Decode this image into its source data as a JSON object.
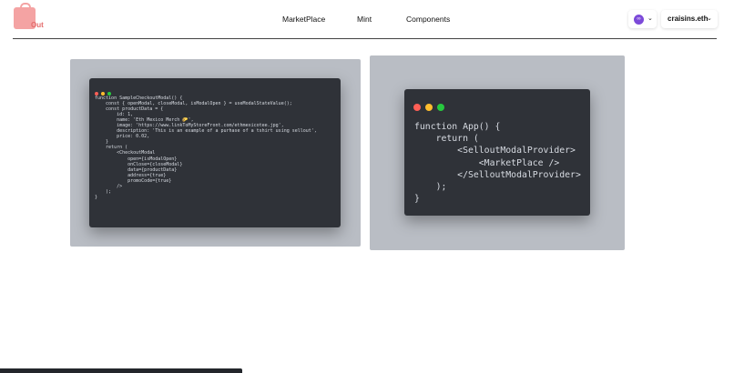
{
  "brand": {
    "logo_text": "Out",
    "accent": "#e46b6b"
  },
  "nav": {
    "items": [
      "MarketPlace",
      "Mint",
      "Components"
    ]
  },
  "wallet": {
    "chain_icon": "polygon-icon",
    "account": "craisins.eth"
  },
  "code_left": {
    "lines": [
      "function SampleCheckoutModal() {",
      "    const { openModal, closeModal, isModalOpen } = useModalStateValue();",
      "    const productData = {",
      "        id: 1,",
      "        name: 'Eth Mexico Merch 🌮',",
      "        image: 'https://www.linkToMyStoreFront.com/ethmexicotee.jpg',",
      "        description: 'This is an example of a purhase of a tshirt using sellout',",
      "        price: 0.02,",
      "    }",
      "    return (",
      "        <CheckoutModal",
      "            open={isModalOpen}",
      "            onClose={closeModal}",
      "            data={productData}",
      "            address={true}",
      "            promoCode={true}",
      "        />",
      "    );",
      "}"
    ]
  },
  "code_right": {
    "lines": [
      "function App() {",
      "    return (",
      "        <SelloutModalProvider>",
      "            <MarketPlace />",
      "        </SelloutModalProvider>",
      "    );",
      "}"
    ]
  }
}
